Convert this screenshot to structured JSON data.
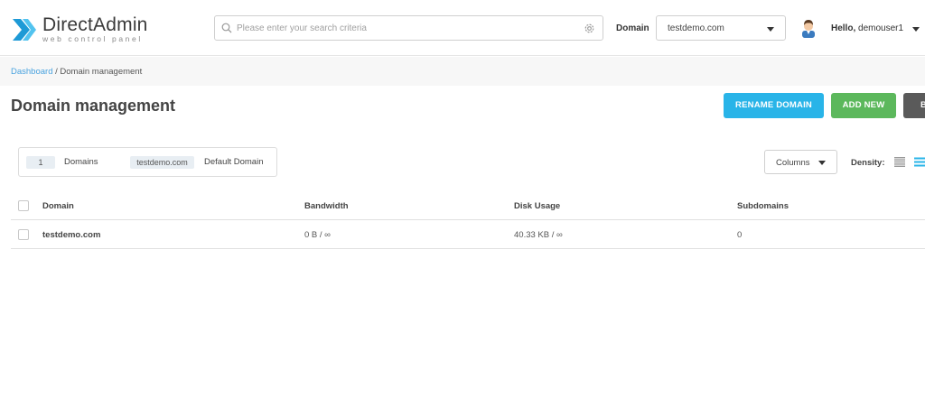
{
  "brand": {
    "title": "DirectAdmin",
    "subtitle": "web control panel"
  },
  "search": {
    "placeholder": "Please enter your search criteria"
  },
  "domain_picker": {
    "label": "Domain",
    "selected": "testdemo.com"
  },
  "user": {
    "greeting": "Hello,",
    "name": "demouser1"
  },
  "breadcrumb": {
    "root": "Dashboard",
    "separator": " / ",
    "current": "Domain management"
  },
  "page": {
    "title": "Domain management"
  },
  "actions": {
    "rename": "RENAME DOMAIN",
    "add": "ADD NEW",
    "third_partial": "B"
  },
  "filters": {
    "count": "1",
    "count_label": "Domains",
    "domain": "testdemo.com",
    "domain_label": "Default Domain"
  },
  "toolbar": {
    "columns": "Columns",
    "density": "Density:"
  },
  "table": {
    "headers": [
      "Domain",
      "Bandwidth",
      "Disk Usage",
      "Subdomains"
    ],
    "rows": [
      {
        "domain": "testdemo.com",
        "bandwidth": "0 B / ∞",
        "disk_usage": "40.33 KB / ∞",
        "subdomains": "0"
      }
    ]
  },
  "colors": {
    "primary": "#29b4e8",
    "success": "#5cb85c",
    "dark": "#5a5a5a",
    "link": "#4aa3df"
  },
  "icons": [
    "directadmin-logo-icon",
    "search-icon",
    "gear-icon",
    "chevron-down-icon",
    "user-avatar-icon",
    "density-compact-icon",
    "density-list-icon"
  ]
}
